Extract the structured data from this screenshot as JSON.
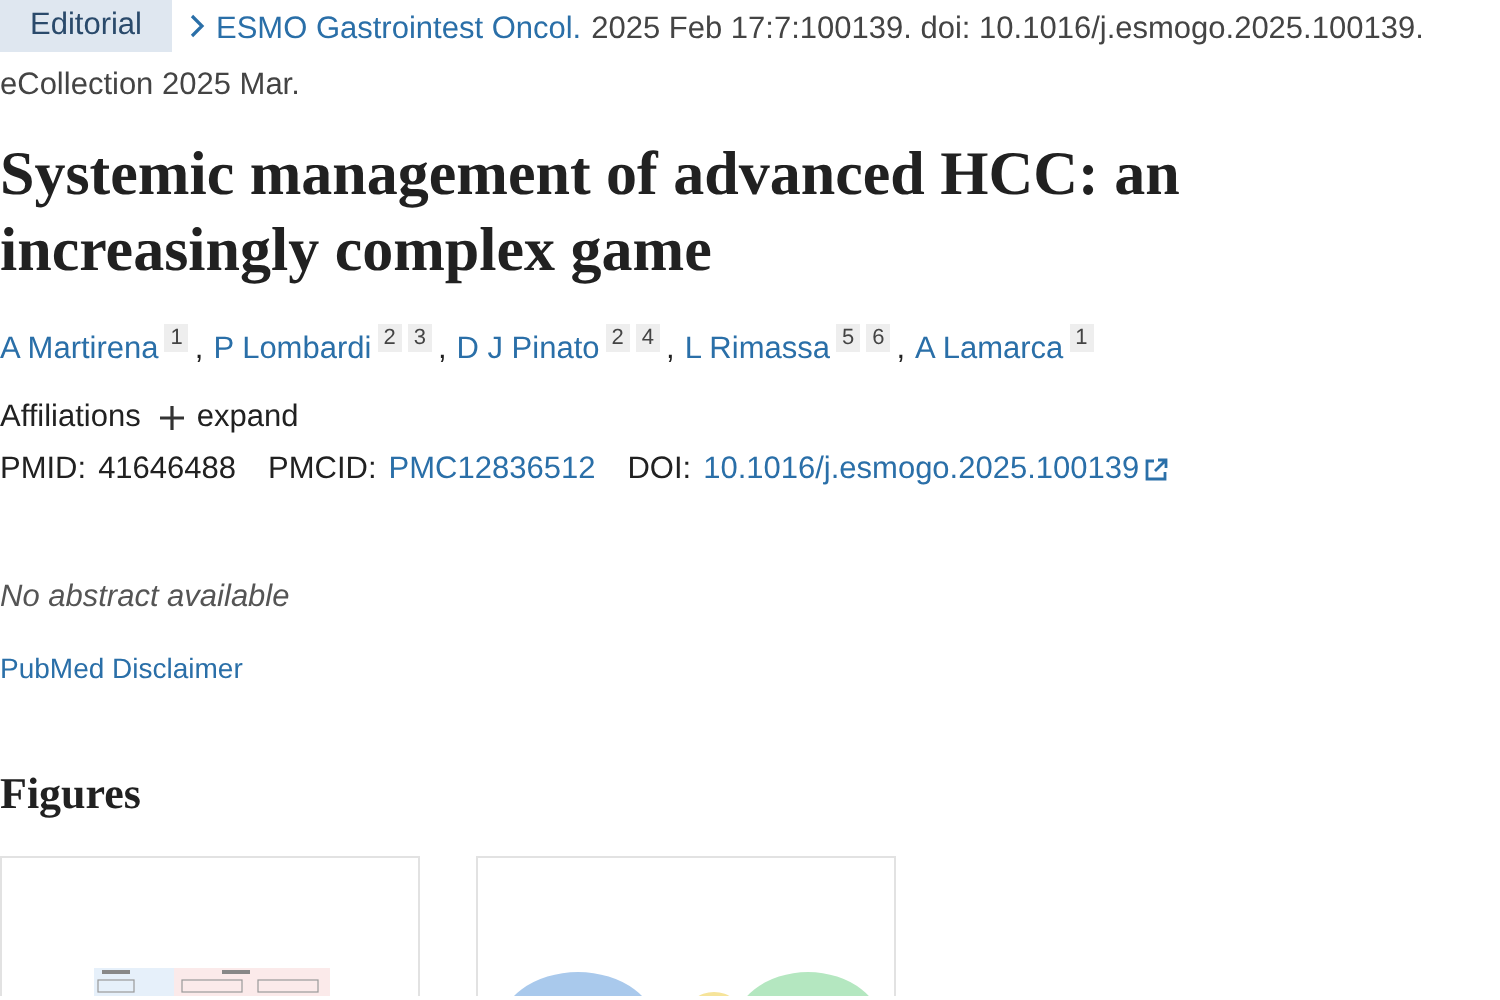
{
  "article_type": "Editorial",
  "journal": "ESMO Gastrointest Oncol.",
  "citation": "2025 Feb 17:7:100139. doi: 10.1016/j.esmogo.2025.100139.",
  "collection": "eCollection 2025 Mar.",
  "title": "Systemic management of advanced HCC: an increasingly complex game",
  "authors": [
    {
      "name": "A Martirena",
      "affiliations": [
        "1"
      ],
      "separator": ","
    },
    {
      "name": "P Lombardi",
      "affiliations": [
        "2",
        "3"
      ],
      "separator": ","
    },
    {
      "name": "D J Pinato",
      "affiliations": [
        "2",
        "4"
      ],
      "separator": ","
    },
    {
      "name": "L Rimassa",
      "affiliations": [
        "5",
        "6"
      ],
      "separator": ","
    },
    {
      "name": "A Lamarca",
      "affiliations": [
        "1"
      ]
    }
  ],
  "affiliations": {
    "label": "Affiliations",
    "toggle": "expand",
    "expanded": false
  },
  "identifiers": [
    {
      "label": "PMID:",
      "value": "41646488",
      "kind": "text"
    },
    {
      "label": "PMCID:",
      "value": "PMC12836512",
      "kind": "link"
    },
    {
      "label": "DOI:",
      "value": "10.1016/j.esmogo.2025.100139",
      "kind": "external"
    }
  ],
  "abstract_note": "No abstract available",
  "disclaimer_link": "PubMed Disclaimer",
  "figures": {
    "heading": "Figures"
  }
}
